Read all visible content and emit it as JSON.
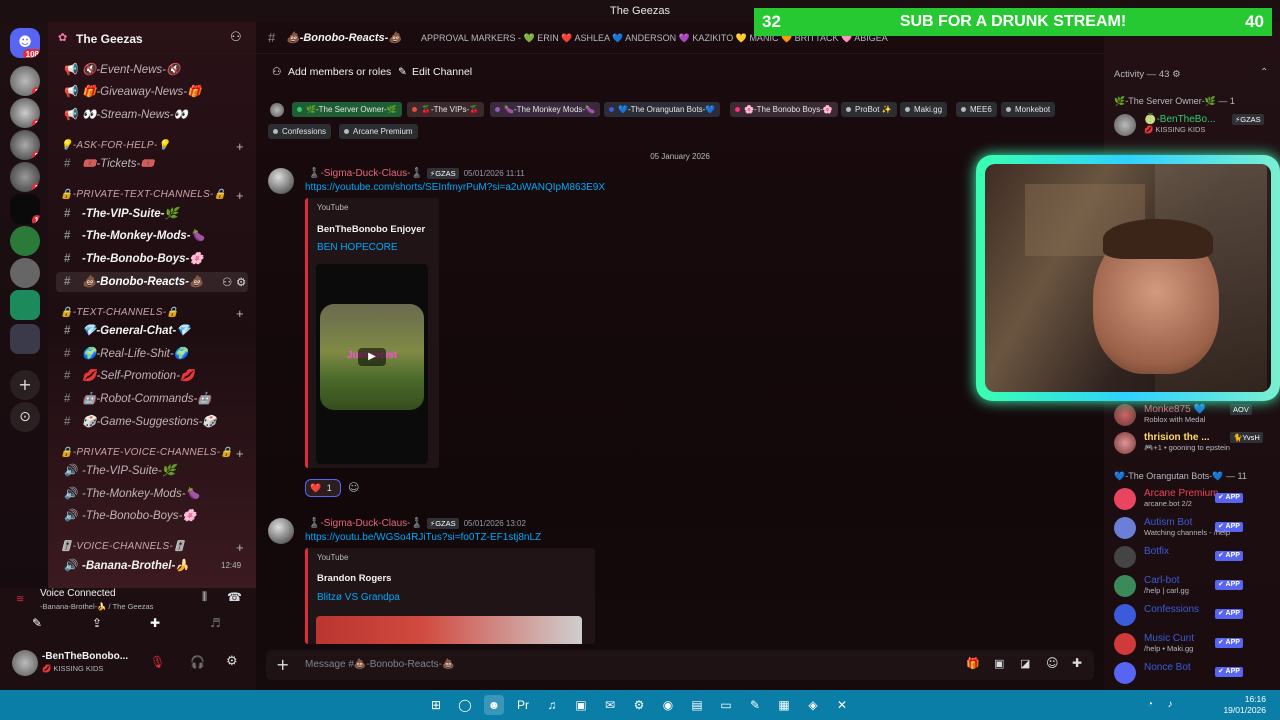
{
  "window": {
    "title": "The Geezas"
  },
  "servers": {
    "mention_badge": "108",
    "badges": [
      "1",
      "1",
      "2",
      "1",
      "1"
    ]
  },
  "sidebar": {
    "server_name": "The Geezas",
    "top_channels": [
      {
        "label": "🔇-Event-News-🔇"
      },
      {
        "label": "🎁-Giveaway-News-🎁"
      },
      {
        "label": "👀-Stream-News-👀"
      }
    ],
    "categories": [
      {
        "label": "💡-ASK-FOR-HELP-💡",
        "channels": [
          {
            "label": "🎟️-Tickets-🎟️"
          }
        ]
      },
      {
        "label": "🔒-PRIVATE-TEXT-CHANNELS-🔒",
        "channels": [
          {
            "label": "-The-VIP-Suite-🌿"
          },
          {
            "label": "-The-Monkey-Mods-🍆"
          },
          {
            "label": "-The-Bonobo-Boys-🌸"
          },
          {
            "label": "💩-Bonobo-Reacts-💩"
          }
        ]
      },
      {
        "label": "🔒-TEXT-CHANNELS-🔒",
        "channels": [
          {
            "label": "💎-General-Chat-💎"
          },
          {
            "label": "🌍-Real-Life-Shit-🌍"
          },
          {
            "label": "💋-Self-Promotion-💋"
          },
          {
            "label": "🤖-Robot-Commands-🤖"
          },
          {
            "label": "🎲-Game-Suggestions-🎲"
          }
        ]
      },
      {
        "label": "🔒-PRIVATE-VOICE-CHANNELS-🔒",
        "channels": [
          {
            "label": "-The-VIP-Suite-🌿"
          },
          {
            "label": "-The-Monkey-Mods-🍆"
          },
          {
            "label": "-The-Bonobo-Boys-🌸"
          }
        ]
      },
      {
        "label": "🎚️-VOICE-CHANNELS-🎚️",
        "channels": [
          {
            "label": "-Banana-Brothel-🍌",
            "time": "12:49"
          }
        ]
      }
    ]
  },
  "voice": {
    "status": "Voice Connected",
    "location": "-Banana-Brothel-🍌 / The Geezas"
  },
  "user": {
    "name": "-BenTheBonobo...",
    "status": "💋 KISSING KIDS"
  },
  "channel": {
    "name": "💩-Bonobo-Reacts-💩",
    "topic": "APPROVAL MARKERS - 💚 ERIN ❤️ ASHLEA 💙 ANDERSON 💜 KAZIKITO 💛 MANIC 🧡 BRITTACK 🩷 ABIGEA",
    "add_members_label": "Add members or roles",
    "edit_channel_label": "Edit Channel",
    "role_chips": [
      {
        "label": "🌿-The Server Owner-🌿",
        "color": "#2ecc71",
        "bg": "#1f5e34"
      },
      {
        "label": "🍒-The VIPs-🍒",
        "color": "#e74c3c",
        "bg": "#3a2a2e"
      },
      {
        "label": "🍆-The Monkey Mods-🍆",
        "color": "#9b59b6",
        "bg": "#3a2a3e"
      },
      {
        "label": "💙-The Orangutan Bots-💙",
        "color": "#3b5bdb",
        "bg": "#2c2d36"
      },
      {
        "label": "🌸-The Bonobo Boys-🌸",
        "color": "#ff2d7f",
        "bg": "#3a2a31"
      },
      {
        "label": "ProBot ✨",
        "color": "#b5babf",
        "bg": "#2c2d31"
      },
      {
        "label": "Maki.gg",
        "color": "#b5babf",
        "bg": "#2c2d31"
      },
      {
        "label": "MEE6",
        "color": "#b5babf",
        "bg": "#2c2d31"
      },
      {
        "label": "Monkebot",
        "color": "#b5babf",
        "bg": "#2c2d31"
      },
      {
        "label": "Confessions",
        "color": "#b5babf",
        "bg": "#2c2d31"
      },
      {
        "label": "Arcane Premium",
        "color": "#b5babf",
        "bg": "#2c2d31"
      }
    ],
    "date_divider": "05 January 2026",
    "messages": [
      {
        "author": "♟️-Sigma-Duck-Claus-♟️",
        "tag": "⚡GZAS",
        "time": "05/01/2026 11:11",
        "link": "https://youtube.com/shorts/SEInfmyrPuM?si=a2uWANQIpM863E9X",
        "embed": {
          "provider": "YouTube",
          "author": "BenTheBonobo Enjoyer",
          "title": "BEN HOPECORE",
          "video_text": "Just racist"
        },
        "reaction": {
          "emoji": "❤️",
          "count": "1"
        }
      },
      {
        "author": "♟️-Sigma-Duck-Claus-♟️",
        "tag": "⚡GZAS",
        "time": "05/01/2026 13:02",
        "link": "https://youtu.be/WGSo4RJiTus?si=fo0TZ-EF1stj8nLZ",
        "embed": {
          "provider": "YouTube",
          "author": "Brandon Rogers",
          "title": "Blitzø VS Grandpa"
        }
      }
    ],
    "composer_placeholder": "Message #💩-Bonobo-Reacts-💩"
  },
  "members": {
    "activity_label": "Activity — 43 ⚙",
    "groups": [
      {
        "header": "🌿-The Server Owner-🌿 — 1",
        "members": [
          {
            "name": "🍈-BenTheBo...",
            "tag": "⚡GZAS",
            "sub": "💋 KISSING KIDS",
            "color": "#2ecc71"
          }
        ]
      },
      {
        "header": "",
        "members": [
          {
            "name": "Monke875 💙",
            "tag": "AOV",
            "sub": "Roblox with Medal",
            "color": "#e2687b"
          },
          {
            "name": "thrision the ...",
            "tag": "🐈YvsH",
            "sub": "🎮+1 • gooning to epstein",
            "color": "#ffd966"
          }
        ]
      },
      {
        "header": "💙-The Orangutan Bots-💙 — 11",
        "members": [
          {
            "name": "Arcane Premium",
            "sub": "arcane.bot 2/2",
            "color": "#e94560",
            "app": "✔ APP"
          },
          {
            "name": "Autism Bot",
            "sub": "Watching channels - /help",
            "color": "#3b5bdb",
            "app": "✔ APP"
          },
          {
            "name": "Botfix",
            "sub": "",
            "color": "#3b5bdb",
            "app": "✔ APP"
          },
          {
            "name": "Carl-bot",
            "sub": "/help | carl.gg",
            "color": "#3b5bdb",
            "app": "✔ APP"
          },
          {
            "name": "Confessions",
            "sub": "",
            "color": "#3b5bdb",
            "app": "✔ APP"
          },
          {
            "name": "Music Cunt",
            "sub": "/help • Maki.gg",
            "color": "#3b5bdb",
            "app": "✔ APP"
          },
          {
            "name": "Nonce Bot",
            "sub": "",
            "color": "#3b5bdb",
            "app": "✔ APP"
          }
        ]
      }
    ]
  },
  "overlay": {
    "sub_left": "32",
    "sub_text": "SUB FOR A DRUNK STREAM!",
    "sub_right": "40"
  },
  "taskbar": {
    "time": "16:16",
    "date": "19/01/2026"
  },
  "colors": {
    "accent_red": "#e02c3a",
    "banner_green": "#27c933",
    "link": "#00a8fc",
    "webcam_border": "#39ffb0"
  }
}
